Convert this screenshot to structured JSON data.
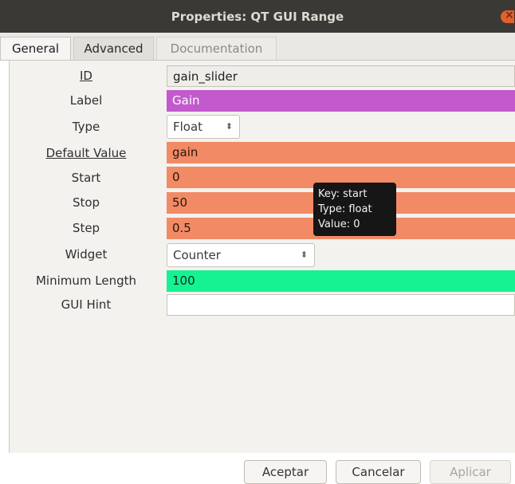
{
  "window": {
    "title": "Properties: QT GUI Range"
  },
  "tabs": [
    {
      "label": "General"
    },
    {
      "label": "Advanced"
    },
    {
      "label": "Documentation"
    }
  ],
  "fields": {
    "id": {
      "label": "ID",
      "value": "gain_slider"
    },
    "label": {
      "label": "Label",
      "value": "Gain"
    },
    "type": {
      "label": "Type",
      "value": "Float"
    },
    "default_value": {
      "label": "Default Value",
      "value": "gain"
    },
    "start": {
      "label": "Start",
      "value": "0"
    },
    "stop": {
      "label": "Stop",
      "value": "50"
    },
    "step": {
      "label": "Step",
      "value": "0.5"
    },
    "widget": {
      "label": "Widget",
      "value": "Counter"
    },
    "min_length": {
      "label": "Minimum Length",
      "value": "100"
    },
    "gui_hint": {
      "label": "GUI Hint",
      "value": ""
    }
  },
  "tooltip": {
    "line1": "Key: start",
    "line2": "Type: float",
    "line3": "Value: 0"
  },
  "buttons": {
    "accept": "Aceptar",
    "cancel": "Cancelar",
    "apply": "Aplicar"
  },
  "colors": {
    "label_field": "#c259cc",
    "numeric_field": "#f28a65",
    "int_field": "#15f292",
    "titlebar": "#3a3936",
    "close_button": "#e2602d"
  }
}
